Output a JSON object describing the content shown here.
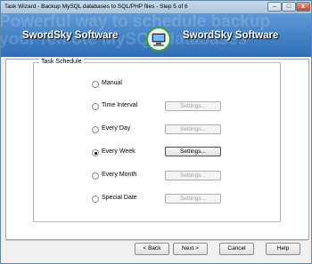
{
  "window": {
    "title": "Task Wizard - Backup MySQL databases to SQL/PHP files - Step 5 of 6",
    "minimize_glyph": "–",
    "maximize_glyph": "□",
    "close_glyph": "x"
  },
  "banner": {
    "brand_left": "SwordSky Software",
    "brand_right": "SwordSky Software",
    "watermark_line1": "Powerful way to schedule backup",
    "watermark_line2": "your remote MySQL databases",
    "logo_icon": "computer-monitor-icon"
  },
  "schedule": {
    "group_label": "Task Schedule",
    "options": [
      {
        "label": "Manual",
        "selected": false,
        "has_settings": false
      },
      {
        "label": "Time Interval",
        "selected": false,
        "has_settings": true,
        "settings_label": "Settings...",
        "settings_enabled": false
      },
      {
        "label": "Every Day",
        "selected": false,
        "has_settings": true,
        "settings_label": "Settings...",
        "settings_enabled": false
      },
      {
        "label": "Every Week",
        "selected": true,
        "has_settings": true,
        "settings_label": "Settings...",
        "settings_enabled": true
      },
      {
        "label": "Every Month",
        "selected": false,
        "has_settings": true,
        "settings_label": "Settings...",
        "settings_enabled": false
      },
      {
        "label": "Special Date",
        "selected": false,
        "has_settings": true,
        "settings_label": "Settings...",
        "settings_enabled": false
      }
    ]
  },
  "footer": {
    "back_label": "< Back",
    "next_label": "Next >",
    "cancel_label": "Cancel",
    "help_label": "Help"
  },
  "colors": {
    "banner_top": "#5d9ad6",
    "banner_bottom": "#2f6db6",
    "titlebar": "#b7cfe5",
    "close_button": "#c4452b"
  }
}
